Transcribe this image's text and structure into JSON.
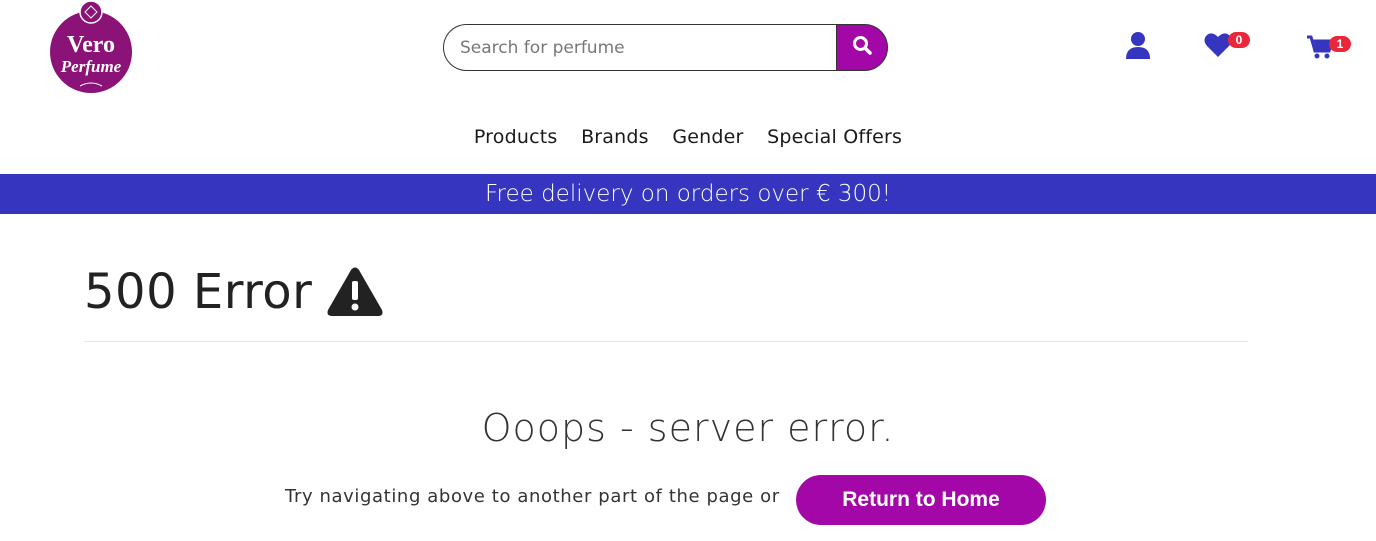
{
  "brand": {
    "logo_line1": "Vero",
    "logo_line2": "Perfume",
    "accent": "#a407a8"
  },
  "search": {
    "placeholder": "Search for perfume",
    "icon": "search-icon"
  },
  "header_icons": {
    "account": {
      "icon": "user-icon"
    },
    "wishlist": {
      "icon": "heart-icon",
      "count": "0"
    },
    "cart": {
      "icon": "cart-icon",
      "count": "1"
    }
  },
  "nav": {
    "items": [
      "Products",
      "Brands",
      "Gender",
      "Special Offers"
    ]
  },
  "banner": {
    "text": "Free delivery on orders over € 300!",
    "color": "#3535c0"
  },
  "error": {
    "title": "500 Error",
    "icon": "warning-icon",
    "message": "Ooops - server error.",
    "hint": "Try navigating above to another part of the page or",
    "button_label": "Return to Home"
  }
}
